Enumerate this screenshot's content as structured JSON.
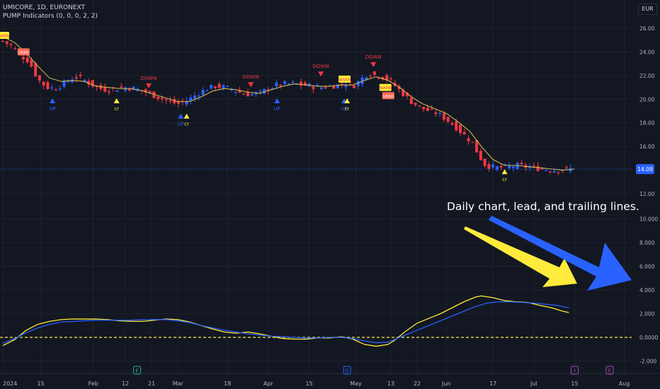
{
  "header": {
    "title": "UMICORE, 1D, EURONEXT",
    "indicator": "PUMP Indicators (0, 0, 0, 2, 2)",
    "currency": "EUR"
  },
  "price_label": "14.09",
  "annotation": "Daily chart, lead, and trailing lines.",
  "colors": {
    "background": "#131722",
    "up_candle": "#2962ff",
    "down_candle": "#f23645",
    "ma_line": "#c9b64a",
    "lead_line": "#ffeb3b",
    "trail_line": "#2962ff",
    "zero_line": "#ffeb3b",
    "arrow_yellow": "#ffeb3b",
    "arrow_blue": "#2962ff",
    "signal_down": "#f23645",
    "signal_up": "#2962ff",
    "signal_cr": "#ffeb3b",
    "warn_bg": "#ffeb3b",
    "warn_text": "#f23645",
    "price_tag": "#2962ff"
  },
  "chart_data": [
    {
      "type": "candlestick",
      "title": "UMICORE, 1D, EURONEXT",
      "ylim": [
        11.8,
        26.9
      ],
      "y_ticks": [
        "26.00",
        "24.00",
        "22.00",
        "20.00",
        "18.00",
        "16.00",
        "12.00"
      ],
      "x_ticks": [
        "2024",
        "15",
        "Feb",
        "12",
        "21",
        "Mar",
        "18",
        "Apr",
        "15",
        "May",
        "13",
        "22",
        "Jun",
        "17",
        "Jul",
        "15",
        "Aug"
      ],
      "x_tick_days": [
        0,
        13,
        31,
        42,
        51,
        60,
        77,
        91,
        105,
        121,
        133,
        142,
        152,
        168,
        182,
        196,
        213
      ],
      "close_series": [
        [
          0,
          24.9
        ],
        [
          3,
          24.5
        ],
        [
          6,
          23.7
        ],
        [
          9,
          23.2
        ],
        [
          12,
          21.7
        ],
        [
          15,
          21.0
        ],
        [
          18,
          20.9
        ],
        [
          22,
          21.5
        ],
        [
          25,
          21.9
        ],
        [
          28,
          21.6
        ],
        [
          30,
          21.3
        ],
        [
          33,
          20.9
        ],
        [
          36,
          20.8
        ],
        [
          39,
          20.9
        ],
        [
          42,
          21.0
        ],
        [
          45,
          20.9
        ],
        [
          48,
          20.7
        ],
        [
          51,
          20.4
        ],
        [
          54,
          20.1
        ],
        [
          57,
          19.8
        ],
        [
          60,
          19.6
        ],
        [
          62,
          19.8
        ],
        [
          64,
          20.0
        ],
        [
          67,
          20.5
        ],
        [
          70,
          20.9
        ],
        [
          73,
          21.1
        ],
        [
          76,
          21.0
        ],
        [
          79,
          20.8
        ],
        [
          82,
          20.5
        ],
        [
          85,
          20.4
        ],
        [
          88,
          20.5
        ],
        [
          91,
          20.9
        ],
        [
          94,
          21.2
        ],
        [
          97,
          21.3
        ],
        [
          100,
          21.3
        ],
        [
          103,
          21.2
        ],
        [
          106,
          21.1
        ],
        [
          109,
          21.0
        ],
        [
          112,
          21.1
        ],
        [
          115,
          21.2
        ],
        [
          118,
          21.4
        ],
        [
          120,
          21.1
        ],
        [
          122,
          21.5
        ],
        [
          125,
          22.2
        ],
        [
          128,
          22.0
        ],
        [
          130,
          21.9
        ],
        [
          133,
          21.5
        ],
        [
          135,
          21.0
        ],
        [
          137,
          20.5
        ],
        [
          140,
          19.8
        ],
        [
          143,
          19.3
        ],
        [
          146,
          19.0
        ],
        [
          149,
          18.8
        ],
        [
          152,
          18.3
        ],
        [
          155,
          17.7
        ],
        [
          158,
          17.0
        ],
        [
          161,
          16.3
        ],
        [
          163,
          15.3
        ],
        [
          165,
          14.5
        ],
        [
          167,
          14.3
        ],
        [
          170,
          14.2
        ],
        [
          173,
          14.3
        ],
        [
          176,
          14.4
        ],
        [
          179,
          14.3
        ],
        [
          182,
          14.2
        ],
        [
          185,
          14.1
        ],
        [
          188,
          14.0
        ],
        [
          191,
          14.0
        ],
        [
          194,
          14.1
        ],
        [
          196,
          14.09
        ]
      ],
      "ma_series": [
        [
          0,
          25.3
        ],
        [
          4,
          24.8
        ],
        [
          8,
          23.9
        ],
        [
          12,
          22.8
        ],
        [
          16,
          21.8
        ],
        [
          20,
          21.5
        ],
        [
          24,
          21.6
        ],
        [
          28,
          21.5
        ],
        [
          32,
          21.1
        ],
        [
          36,
          21.0
        ],
        [
          40,
          20.9
        ],
        [
          44,
          20.9
        ],
        [
          48,
          20.7
        ],
        [
          52,
          20.4
        ],
        [
          56,
          20.1
        ],
        [
          60,
          19.8
        ],
        [
          64,
          19.8
        ],
        [
          68,
          20.2
        ],
        [
          72,
          20.7
        ],
        [
          76,
          20.9
        ],
        [
          80,
          20.8
        ],
        [
          84,
          20.6
        ],
        [
          88,
          20.5
        ],
        [
          92,
          20.8
        ],
        [
          96,
          21.1
        ],
        [
          100,
          21.3
        ],
        [
          104,
          21.2
        ],
        [
          108,
          21.1
        ],
        [
          112,
          21.1
        ],
        [
          116,
          21.2
        ],
        [
          120,
          21.2
        ],
        [
          124,
          21.6
        ],
        [
          128,
          21.9
        ],
        [
          132,
          21.6
        ],
        [
          136,
          21.0
        ],
        [
          140,
          20.2
        ],
        [
          144,
          19.6
        ],
        [
          148,
          19.2
        ],
        [
          152,
          18.8
        ],
        [
          156,
          18.1
        ],
        [
          160,
          17.3
        ],
        [
          164,
          16.0
        ],
        [
          168,
          14.9
        ],
        [
          172,
          14.4
        ],
        [
          176,
          14.4
        ],
        [
          180,
          14.3
        ],
        [
          184,
          14.2
        ],
        [
          188,
          14.1
        ],
        [
          192,
          14.0
        ],
        [
          196,
          14.1
        ]
      ],
      "signals": [
        {
          "day": 17,
          "type": "up",
          "label": "UP",
          "price": 19.9
        },
        {
          "day": 39,
          "type": "cr",
          "label": "cr",
          "price": 19.9
        },
        {
          "day": 50,
          "type": "down",
          "label": "DOWN",
          "price": 21.1
        },
        {
          "day": 61,
          "type": "up",
          "label": "UP",
          "price": 18.6
        },
        {
          "day": 63,
          "type": "cr",
          "label": "cr",
          "price": 18.6
        },
        {
          "day": 85,
          "type": "down",
          "label": "DOWN",
          "price": 21.2
        },
        {
          "day": 94,
          "type": "up",
          "label": "UP",
          "price": 19.9
        },
        {
          "day": 109,
          "type": "down",
          "label": "DOWN",
          "price": 22.1
        },
        {
          "day": 117,
          "type": "up",
          "label": "UP",
          "price": 19.9
        },
        {
          "day": 118,
          "type": "cr",
          "label": "cr",
          "price": 19.9
        },
        {
          "day": 127,
          "type": "down",
          "label": "DOWN",
          "price": 22.9
        },
        {
          "day": 172,
          "type": "cr",
          "label": "cr",
          "price": 13.9
        }
      ],
      "warn_flags": [
        {
          "day": 0,
          "label": "WARN",
          "price": 25.4
        },
        {
          "day": 117,
          "label": "WARN",
          "price": 21.7
        },
        {
          "day": 131,
          "label": "WARN",
          "price": 21.0
        }
      ],
      "lead_flags": [
        {
          "day": 7,
          "label": "LEAD",
          "price": 24.0
        },
        {
          "day": 132,
          "label": "LEAD",
          "price": 20.3
        }
      ]
    },
    {
      "type": "line",
      "ylim": [
        -2.4,
        4.6
      ],
      "y_ticks": [
        "10.000",
        "8.000",
        "6.000",
        "4.000",
        "2.000",
        "0.0000",
        "-2.000"
      ],
      "y_tick_values": [
        10,
        8,
        6,
        4,
        2,
        0,
        -2
      ],
      "series": [
        {
          "values": [
            [
              0,
              -0.7
            ],
            [
              4,
              -0.2
            ],
            [
              8,
              0.6
            ],
            [
              12,
              1.1
            ],
            [
              16,
              1.35
            ],
            [
              20,
              1.5
            ],
            [
              24,
              1.55
            ],
            [
              28,
              1.55
            ],
            [
              32,
              1.55
            ],
            [
              36,
              1.5
            ],
            [
              40,
              1.4
            ],
            [
              44,
              1.35
            ],
            [
              48,
              1.35
            ],
            [
              52,
              1.45
            ],
            [
              56,
              1.55
            ],
            [
              60,
              1.5
            ],
            [
              64,
              1.3
            ],
            [
              68,
              1.0
            ],
            [
              72,
              0.7
            ],
            [
              76,
              0.45
            ],
            [
              80,
              0.35
            ],
            [
              84,
              0.45
            ],
            [
              88,
              0.3
            ],
            [
              92,
              0.1
            ],
            [
              96,
              -0.1
            ],
            [
              100,
              -0.15
            ],
            [
              104,
              -0.15
            ],
            [
              108,
              -0.05
            ],
            [
              112,
              -0.05
            ],
            [
              116,
              0.05
            ],
            [
              120,
              -0.15
            ],
            [
              124,
              -0.6
            ],
            [
              128,
              -0.75
            ],
            [
              132,
              -0.6
            ],
            [
              134,
              -0.3
            ],
            [
              138,
              0.5
            ],
            [
              142,
              1.2
            ],
            [
              146,
              1.6
            ],
            [
              150,
              2.0
            ],
            [
              154,
              2.5
            ],
            [
              158,
              3.0
            ],
            [
              162,
              3.4
            ],
            [
              164,
              3.5
            ],
            [
              168,
              3.35
            ],
            [
              172,
              3.1
            ],
            [
              176,
              3.0
            ],
            [
              180,
              2.95
            ],
            [
              184,
              2.7
            ],
            [
              188,
              2.5
            ],
            [
              192,
              2.2
            ],
            [
              194,
              2.1
            ]
          ]
        },
        {
          "values": [
            [
              0,
              -0.5
            ],
            [
              4,
              -0.1
            ],
            [
              8,
              0.4
            ],
            [
              12,
              0.8
            ],
            [
              16,
              1.1
            ],
            [
              20,
              1.3
            ],
            [
              24,
              1.35
            ],
            [
              28,
              1.4
            ],
            [
              32,
              1.45
            ],
            [
              36,
              1.45
            ],
            [
              40,
              1.45
            ],
            [
              44,
              1.45
            ],
            [
              48,
              1.5
            ],
            [
              52,
              1.5
            ],
            [
              56,
              1.5
            ],
            [
              60,
              1.4
            ],
            [
              64,
              1.25
            ],
            [
              68,
              1.0
            ],
            [
              72,
              0.8
            ],
            [
              76,
              0.6
            ],
            [
              80,
              0.45
            ],
            [
              84,
              0.3
            ],
            [
              88,
              0.2
            ],
            [
              92,
              0.1
            ],
            [
              96,
              0.05
            ],
            [
              100,
              0.0
            ],
            [
              104,
              -0.05
            ],
            [
              108,
              -0.05
            ],
            [
              112,
              0.0
            ],
            [
              116,
              0.0
            ],
            [
              120,
              -0.1
            ],
            [
              124,
              -0.3
            ],
            [
              128,
              -0.45
            ],
            [
              132,
              -0.4
            ],
            [
              134,
              -0.2
            ],
            [
              138,
              0.2
            ],
            [
              142,
              0.6
            ],
            [
              146,
              1.0
            ],
            [
              150,
              1.4
            ],
            [
              154,
              1.8
            ],
            [
              158,
              2.2
            ],
            [
              162,
              2.6
            ],
            [
              166,
              2.9
            ],
            [
              170,
              3.0
            ],
            [
              174,
              3.0
            ],
            [
              178,
              2.95
            ],
            [
              182,
              2.9
            ],
            [
              186,
              2.8
            ],
            [
              190,
              2.7
            ],
            [
              194,
              2.5
            ]
          ]
        }
      ],
      "zero_line": 0
    }
  ]
}
